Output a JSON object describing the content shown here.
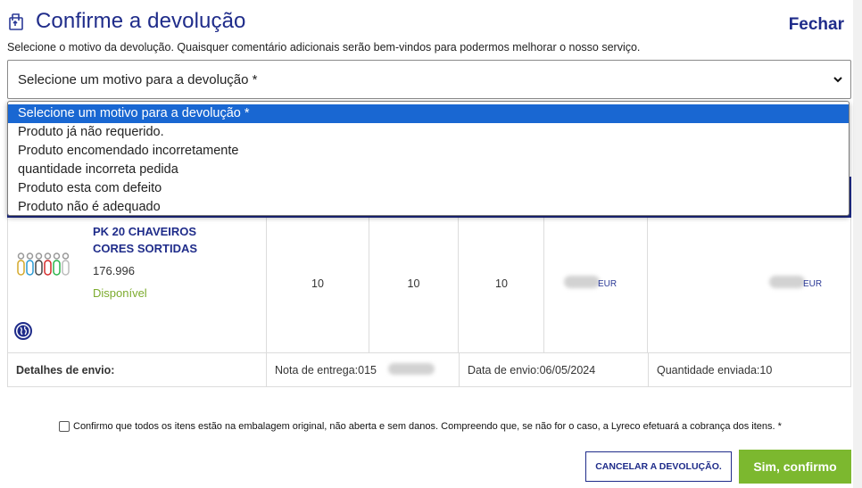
{
  "header": {
    "title": "Confirme a devolução",
    "close_label": "Fechar",
    "subtitle": "Selecione o motivo da devolução. Quaisquer comentário adicionais serão bem-vindos para podermos melhorar o nosso serviço."
  },
  "reason_select": {
    "selected": "Selecione um motivo para a devolução *",
    "options": [
      "Selecione um motivo para a devolução *",
      "Produto já não requerido.",
      "Produto encomendado incorretamente",
      "quantidade incorreta pedida",
      "Produto esta com defeito",
      "Produto não é adequado"
    ]
  },
  "product": {
    "name_line1": "PK 20 CHAVEIROS",
    "name_line2": "CORES SORTIDAS",
    "code": "176.996",
    "status": "Disponível",
    "qty_ordered": "10",
    "qty_delivered": "10",
    "qty_return": "10",
    "unit_price_currency": "EUR",
    "total_currency": "EUR"
  },
  "shipping": {
    "label": "Detalhes de envio:",
    "delivery_note": "Nota de entrega:015",
    "ship_date": "Data de envio:06/05/2024",
    "qty_sent": "Quantidade enviada:10"
  },
  "confirmation": {
    "text": "Confirmo que todos os itens estão na embalagem original, não aberta e sem danos. Compreendo que, se não for o caso, a Lyreco efetuará a cobrança dos itens. *"
  },
  "buttons": {
    "cancel": "CANCELAR A DEVOLUÇÃO.",
    "confirm": "Sim, confirmo"
  },
  "colors": {
    "brand_blue": "#1f2c8a",
    "accent_green": "#7cb82f",
    "select_highlight": "#1967d2"
  }
}
